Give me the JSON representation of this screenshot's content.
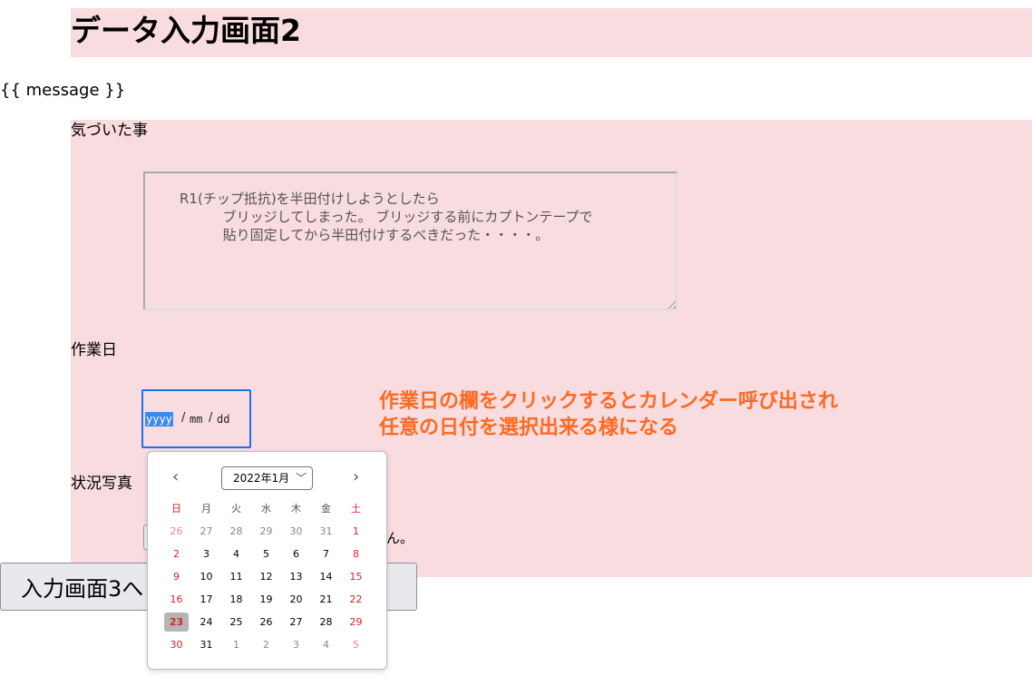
{
  "page": {
    "title": "データ入力画面2",
    "message": "{{ message }}"
  },
  "notes": {
    "label": "気づいた事",
    "lines": [
      "R1(チップ抵抗)を半田付けしようとしたら",
      "          ブリッジしてしまった。 ブリッジする前にカプトンテープで",
      "          貼り固定してから半田付けするべきだった・・・・。"
    ]
  },
  "work_date": {
    "label": "作業日",
    "year_placeholder": "yyyy",
    "month_placeholder": "mm",
    "day_placeholder": "dd",
    "separator": "/"
  },
  "annotation": {
    "line1": "作業日の欄をクリックするとカレンダー呼び出され",
    "line2": "任意の日付を選択出来る様になる",
    "color": "#ff6a22"
  },
  "photo": {
    "label": "状況写真",
    "status_text": "ん。"
  },
  "next_button": {
    "label": "入力画面3へ"
  },
  "calendar": {
    "month_label": "2022年1月",
    "prev_icon": "‹",
    "next_icon": "›",
    "weekdays": [
      "日",
      "月",
      "火",
      "水",
      "木",
      "金",
      "土"
    ],
    "weeks": [
      [
        {
          "d": "26",
          "o": true
        },
        {
          "d": "27",
          "o": true
        },
        {
          "d": "28",
          "o": true
        },
        {
          "d": "29",
          "o": true
        },
        {
          "d": "30",
          "o": true
        },
        {
          "d": "31",
          "o": true
        },
        {
          "d": "1"
        }
      ],
      [
        {
          "d": "2"
        },
        {
          "d": "3"
        },
        {
          "d": "4"
        },
        {
          "d": "5"
        },
        {
          "d": "6"
        },
        {
          "d": "7"
        },
        {
          "d": "8"
        }
      ],
      [
        {
          "d": "9"
        },
        {
          "d": "10"
        },
        {
          "d": "11"
        },
        {
          "d": "12"
        },
        {
          "d": "13"
        },
        {
          "d": "14"
        },
        {
          "d": "15"
        }
      ],
      [
        {
          "d": "16"
        },
        {
          "d": "17"
        },
        {
          "d": "18"
        },
        {
          "d": "19"
        },
        {
          "d": "20"
        },
        {
          "d": "21"
        },
        {
          "d": "22"
        }
      ],
      [
        {
          "d": "23",
          "sel": true
        },
        {
          "d": "24"
        },
        {
          "d": "25"
        },
        {
          "d": "26"
        },
        {
          "d": "27"
        },
        {
          "d": "28"
        },
        {
          "d": "29"
        }
      ],
      [
        {
          "d": "30"
        },
        {
          "d": "31"
        },
        {
          "d": "1",
          "o": true
        },
        {
          "d": "2",
          "o": true
        },
        {
          "d": "3",
          "o": true
        },
        {
          "d": "4",
          "o": true
        },
        {
          "d": "5",
          "o": true
        }
      ]
    ],
    "weekend_color": "#d6232a",
    "selected_bg": "#b5b5b5"
  },
  "colors": {
    "band": "#f8dce0",
    "focus": "#1a73e8"
  }
}
